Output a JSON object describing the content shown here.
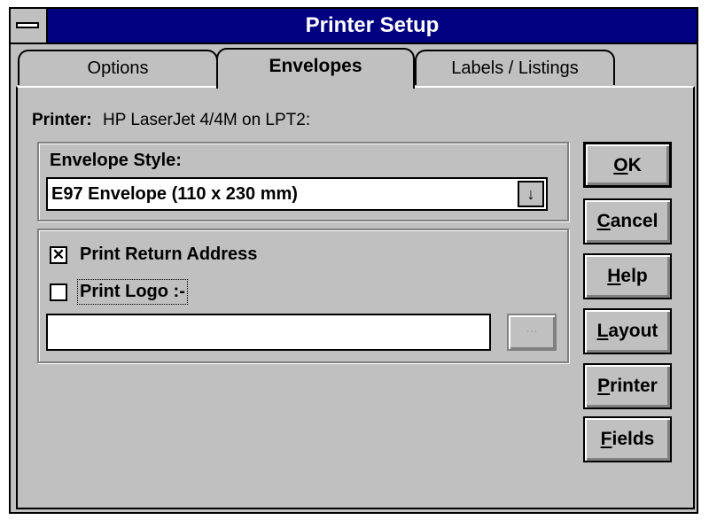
{
  "window": {
    "title": "Printer Setup"
  },
  "tabs": [
    {
      "label": "Options"
    },
    {
      "label": "Envelopes"
    },
    {
      "label": "Labels / Listings"
    }
  ],
  "printer": {
    "label": "Printer:",
    "value": "HP LaserJet 4/4M on LPT2:"
  },
  "envelope": {
    "label": "Envelope Style:",
    "value": "E97 Envelope (110 x 230 mm)",
    "dropdown_glyph": "↓"
  },
  "options": {
    "print_return_address": {
      "label": "Print Return Address",
      "checked": true,
      "mark": "✕"
    },
    "print_logo": {
      "label": "Print Logo :-",
      "checked": false
    },
    "logo_path": {
      "value": ""
    },
    "browse_label": "..."
  },
  "buttons": {
    "ok": {
      "first": "O",
      "rest": "K"
    },
    "cancel": {
      "first": "C",
      "rest": "ancel"
    },
    "help": {
      "first": "H",
      "rest": "elp"
    },
    "layout": {
      "first": "L",
      "rest": "ayout"
    },
    "printer": {
      "first": "P",
      "rest": "rinter"
    },
    "fields": {
      "first": "F",
      "rest": "ields"
    }
  }
}
